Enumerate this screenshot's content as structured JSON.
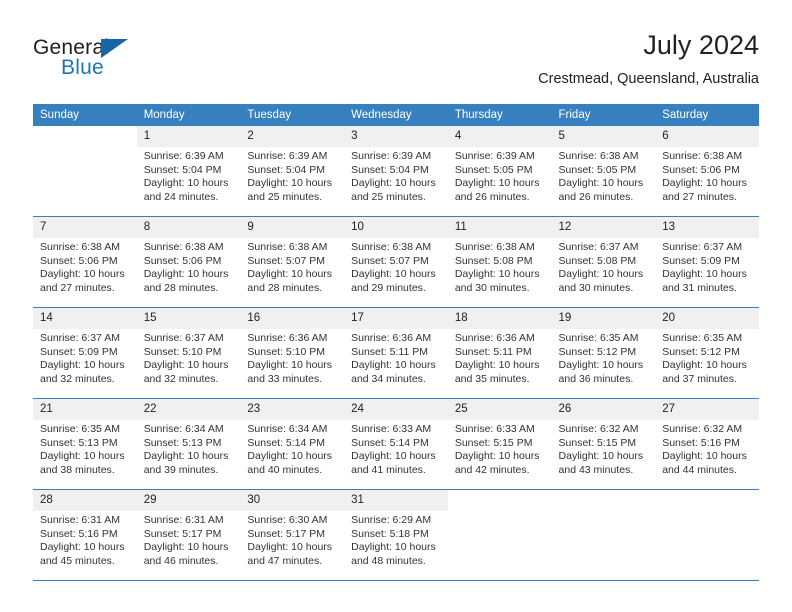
{
  "brand": {
    "name_part1": "General",
    "name_part2": "Blue",
    "triangle_icon": "triangle-icon",
    "accent_color": "#1b75bb"
  },
  "header": {
    "title": "July 2024",
    "location": "Crestmead, Queensland, Australia"
  },
  "theme": {
    "header_row_bg": "#3780c0",
    "day_number_bg": "#f0f0f0",
    "grid_line": "#3780c0",
    "text": "#222222"
  },
  "weekdays": [
    "Sunday",
    "Monday",
    "Tuesday",
    "Wednesday",
    "Thursday",
    "Friday",
    "Saturday"
  ],
  "labels": {
    "sunrise_prefix": "Sunrise: ",
    "sunset_prefix": "Sunset: ",
    "daylight_prefix": "Daylight: "
  },
  "weeks": [
    [
      {
        "empty": true
      },
      {
        "day": "1",
        "sunrise": "Sunrise: 6:39 AM",
        "sunset": "Sunset: 5:04 PM",
        "daylight": "Daylight: 10 hours and 24 minutes."
      },
      {
        "day": "2",
        "sunrise": "Sunrise: 6:39 AM",
        "sunset": "Sunset: 5:04 PM",
        "daylight": "Daylight: 10 hours and 25 minutes."
      },
      {
        "day": "3",
        "sunrise": "Sunrise: 6:39 AM",
        "sunset": "Sunset: 5:04 PM",
        "daylight": "Daylight: 10 hours and 25 minutes."
      },
      {
        "day": "4",
        "sunrise": "Sunrise: 6:39 AM",
        "sunset": "Sunset: 5:05 PM",
        "daylight": "Daylight: 10 hours and 26 minutes."
      },
      {
        "day": "5",
        "sunrise": "Sunrise: 6:38 AM",
        "sunset": "Sunset: 5:05 PM",
        "daylight": "Daylight: 10 hours and 26 minutes."
      },
      {
        "day": "6",
        "sunrise": "Sunrise: 6:38 AM",
        "sunset": "Sunset: 5:06 PM",
        "daylight": "Daylight: 10 hours and 27 minutes."
      }
    ],
    [
      {
        "day": "7",
        "sunrise": "Sunrise: 6:38 AM",
        "sunset": "Sunset: 5:06 PM",
        "daylight": "Daylight: 10 hours and 27 minutes."
      },
      {
        "day": "8",
        "sunrise": "Sunrise: 6:38 AM",
        "sunset": "Sunset: 5:06 PM",
        "daylight": "Daylight: 10 hours and 28 minutes."
      },
      {
        "day": "9",
        "sunrise": "Sunrise: 6:38 AM",
        "sunset": "Sunset: 5:07 PM",
        "daylight": "Daylight: 10 hours and 28 minutes."
      },
      {
        "day": "10",
        "sunrise": "Sunrise: 6:38 AM",
        "sunset": "Sunset: 5:07 PM",
        "daylight": "Daylight: 10 hours and 29 minutes."
      },
      {
        "day": "11",
        "sunrise": "Sunrise: 6:38 AM",
        "sunset": "Sunset: 5:08 PM",
        "daylight": "Daylight: 10 hours and 30 minutes."
      },
      {
        "day": "12",
        "sunrise": "Sunrise: 6:37 AM",
        "sunset": "Sunset: 5:08 PM",
        "daylight": "Daylight: 10 hours and 30 minutes."
      },
      {
        "day": "13",
        "sunrise": "Sunrise: 6:37 AM",
        "sunset": "Sunset: 5:09 PM",
        "daylight": "Daylight: 10 hours and 31 minutes."
      }
    ],
    [
      {
        "day": "14",
        "sunrise": "Sunrise: 6:37 AM",
        "sunset": "Sunset: 5:09 PM",
        "daylight": "Daylight: 10 hours and 32 minutes."
      },
      {
        "day": "15",
        "sunrise": "Sunrise: 6:37 AM",
        "sunset": "Sunset: 5:10 PM",
        "daylight": "Daylight: 10 hours and 32 minutes."
      },
      {
        "day": "16",
        "sunrise": "Sunrise: 6:36 AM",
        "sunset": "Sunset: 5:10 PM",
        "daylight": "Daylight: 10 hours and 33 minutes."
      },
      {
        "day": "17",
        "sunrise": "Sunrise: 6:36 AM",
        "sunset": "Sunset: 5:11 PM",
        "daylight": "Daylight: 10 hours and 34 minutes."
      },
      {
        "day": "18",
        "sunrise": "Sunrise: 6:36 AM",
        "sunset": "Sunset: 5:11 PM",
        "daylight": "Daylight: 10 hours and 35 minutes."
      },
      {
        "day": "19",
        "sunrise": "Sunrise: 6:35 AM",
        "sunset": "Sunset: 5:12 PM",
        "daylight": "Daylight: 10 hours and 36 minutes."
      },
      {
        "day": "20",
        "sunrise": "Sunrise: 6:35 AM",
        "sunset": "Sunset: 5:12 PM",
        "daylight": "Daylight: 10 hours and 37 minutes."
      }
    ],
    [
      {
        "day": "21",
        "sunrise": "Sunrise: 6:35 AM",
        "sunset": "Sunset: 5:13 PM",
        "daylight": "Daylight: 10 hours and 38 minutes."
      },
      {
        "day": "22",
        "sunrise": "Sunrise: 6:34 AM",
        "sunset": "Sunset: 5:13 PM",
        "daylight": "Daylight: 10 hours and 39 minutes."
      },
      {
        "day": "23",
        "sunrise": "Sunrise: 6:34 AM",
        "sunset": "Sunset: 5:14 PM",
        "daylight": "Daylight: 10 hours and 40 minutes."
      },
      {
        "day": "24",
        "sunrise": "Sunrise: 6:33 AM",
        "sunset": "Sunset: 5:14 PM",
        "daylight": "Daylight: 10 hours and 41 minutes."
      },
      {
        "day": "25",
        "sunrise": "Sunrise: 6:33 AM",
        "sunset": "Sunset: 5:15 PM",
        "daylight": "Daylight: 10 hours and 42 minutes."
      },
      {
        "day": "26",
        "sunrise": "Sunrise: 6:32 AM",
        "sunset": "Sunset: 5:15 PM",
        "daylight": "Daylight: 10 hours and 43 minutes."
      },
      {
        "day": "27",
        "sunrise": "Sunrise: 6:32 AM",
        "sunset": "Sunset: 5:16 PM",
        "daylight": "Daylight: 10 hours and 44 minutes."
      }
    ],
    [
      {
        "day": "28",
        "sunrise": "Sunrise: 6:31 AM",
        "sunset": "Sunset: 5:16 PM",
        "daylight": "Daylight: 10 hours and 45 minutes."
      },
      {
        "day": "29",
        "sunrise": "Sunrise: 6:31 AM",
        "sunset": "Sunset: 5:17 PM",
        "daylight": "Daylight: 10 hours and 46 minutes."
      },
      {
        "day": "30",
        "sunrise": "Sunrise: 6:30 AM",
        "sunset": "Sunset: 5:17 PM",
        "daylight": "Daylight: 10 hours and 47 minutes."
      },
      {
        "day": "31",
        "sunrise": "Sunrise: 6:29 AM",
        "sunset": "Sunset: 5:18 PM",
        "daylight": "Daylight: 10 hours and 48 minutes."
      },
      {
        "empty": true
      },
      {
        "empty": true
      },
      {
        "empty": true
      }
    ]
  ]
}
